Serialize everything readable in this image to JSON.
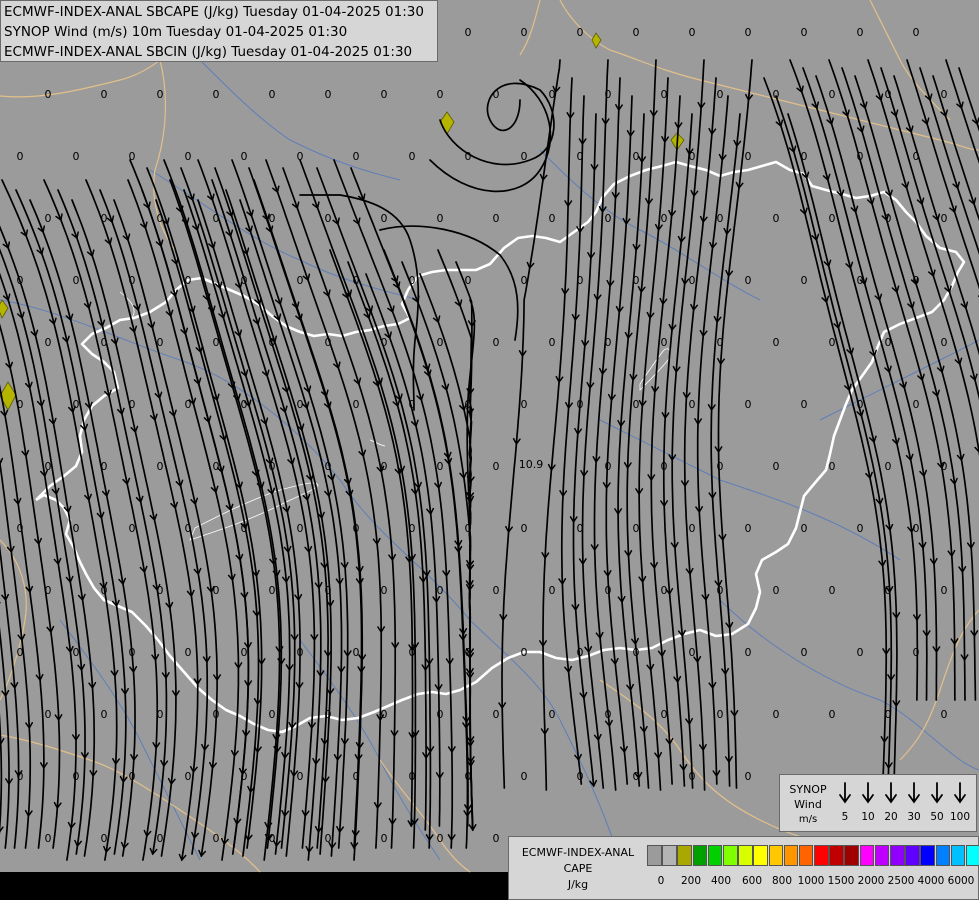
{
  "titles": {
    "line1": "ECMWF-INDEX-ANAL SBCAPE (J/kg) Tuesday 01-04-2025 01:30",
    "line2": "SYNOP Wind (m/s) 10m Tuesday 01-04-2025 01:30",
    "line3": "ECMWF-INDEX-ANAL SBCIN (J/kg) Tuesday 01-04-2025 01:30"
  },
  "colors": {
    "map_background": "#9b9b9b",
    "border_color": "#ffffff",
    "coast_color": "#e2c08a",
    "river_color": "#5f7fb8",
    "streamline_color": "#000000",
    "cape_patch_color": "#b5b500"
  },
  "wind_legend": {
    "title_line1": "SYNOP",
    "title_line2": "Wind",
    "unit": "m/s",
    "speeds": [
      "5",
      "10",
      "20",
      "30",
      "50",
      "100"
    ]
  },
  "cape_legend": {
    "title_line1": "ECMWF-INDEX-ANAL",
    "title_line2": "CAPE",
    "unit": "J/kg",
    "swatch_colors": [
      "#9b9b9b",
      "#b4b4b4",
      "#a8a800",
      "#00a000",
      "#00d000",
      "#80ff00",
      "#d8ff00",
      "#ffff00",
      "#ffc800",
      "#ff9600",
      "#ff6400",
      "#ff0000",
      "#c00000",
      "#a00000",
      "#ff00ff",
      "#c000ff",
      "#9000ff",
      "#6000ff",
      "#0000ff",
      "#0080ff",
      "#00c0ff",
      "#00ffff",
      "#80ffff",
      "#ffffff"
    ],
    "ticks": [
      "0",
      "200",
      "400",
      "600",
      "800",
      "1000",
      "1500",
      "2000",
      "2500",
      "4000",
      "6000"
    ]
  },
  "cin_labels": {
    "zero_text": "0",
    "special_label": "10.9"
  }
}
